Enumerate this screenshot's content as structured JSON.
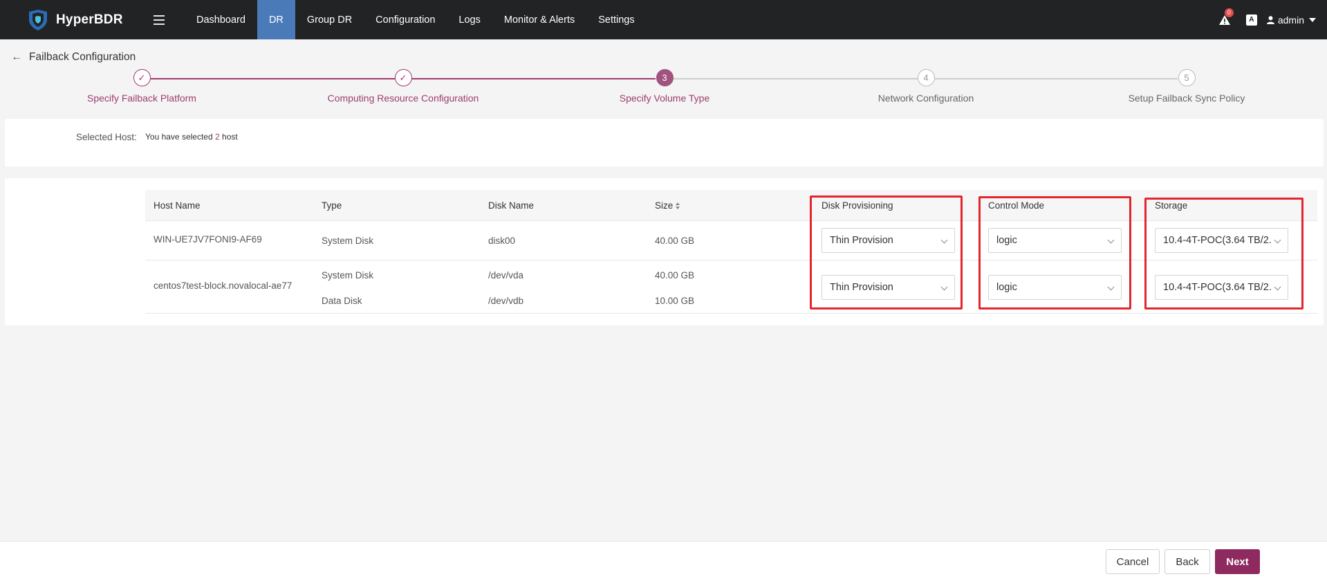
{
  "app": {
    "brand": "HyperBDR"
  },
  "nav": {
    "items": [
      {
        "label": "Dashboard"
      },
      {
        "label": "DR"
      },
      {
        "label": "Group DR"
      },
      {
        "label": "Configuration"
      },
      {
        "label": "Logs"
      },
      {
        "label": "Monitor & Alerts"
      },
      {
        "label": "Settings"
      }
    ],
    "active": "DR",
    "alert_count": "0",
    "lang_icon": "A",
    "user": "admin"
  },
  "page": {
    "title": "Failback Configuration"
  },
  "steps": [
    {
      "label": "Specify Failback Platform",
      "state": "done",
      "num": "1"
    },
    {
      "label": "Computing Resource Configuration",
      "state": "done",
      "num": "2"
    },
    {
      "label": "Specify Volume Type",
      "state": "current",
      "num": "3"
    },
    {
      "label": "Network Configuration",
      "state": "todo",
      "num": "4"
    },
    {
      "label": "Setup Failback Sync Policy",
      "state": "todo",
      "num": "5"
    }
  ],
  "selection": {
    "label": "Selected Host:",
    "prefix": "You have selected",
    "count": "2",
    "suffix": "host"
  },
  "table": {
    "headers": {
      "host_name": "Host Name",
      "type": "Type",
      "disk_name": "Disk Name",
      "size": "Size",
      "provisioning": "Disk Provisioning",
      "control_mode": "Control Mode",
      "storage": "Storage"
    },
    "rows": [
      {
        "host": "WIN-UE7JV7FONI9-AF69",
        "disks": [
          {
            "type": "System Disk",
            "name": "disk00",
            "size": "40.00 GB"
          }
        ],
        "provisioning": "Thin Provision",
        "control_mode": "logic",
        "storage": "10.4-4T-POC(3.64 TB/2."
      },
      {
        "host": "centos7test-block.novalocal-ae77",
        "disks": [
          {
            "type": "System Disk",
            "name": "/dev/vda",
            "size": "40.00 GB"
          },
          {
            "type": "Data Disk",
            "name": "/dev/vdb",
            "size": "10.00 GB"
          }
        ],
        "provisioning": "Thin Provision",
        "control_mode": "logic",
        "storage": "10.4-4T-POC(3.64 TB/2."
      }
    ]
  },
  "footer": {
    "cancel": "Cancel",
    "back": "Back",
    "next": "Next"
  },
  "colors": {
    "accent": "#8e2a5f",
    "nav_active": "#4a7ab8",
    "highlight": "#e3262b"
  }
}
